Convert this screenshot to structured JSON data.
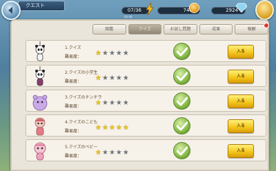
{
  "header": {
    "title": "クエスト",
    "stamina": "07/36",
    "stamina_sub": "06:08",
    "gold": "746",
    "gems": "2924"
  },
  "tabs": [
    "図鑑",
    "クイズ",
    "お試し問題",
    "成果",
    "報酬"
  ],
  "active_tab": 1,
  "difficulty_label": "難易度：",
  "enter_label": "入る",
  "quizzes": [
    {
      "name": "1.クイズ",
      "stars": 0,
      "completed": true
    },
    {
      "name": "2.クイズの小学生",
      "stars": 0,
      "completed": true
    },
    {
      "name": "3.クイズのチンチラ",
      "stars": 0,
      "completed": true
    },
    {
      "name": "4.クイズのこども",
      "stars": 5,
      "completed": true
    },
    {
      "name": "5.クイズのベビー",
      "stars": 0,
      "completed": true
    }
  ],
  "colors": {
    "accent": "#f3c51a",
    "check": "#7fb23f",
    "panel": "#eae5da"
  }
}
